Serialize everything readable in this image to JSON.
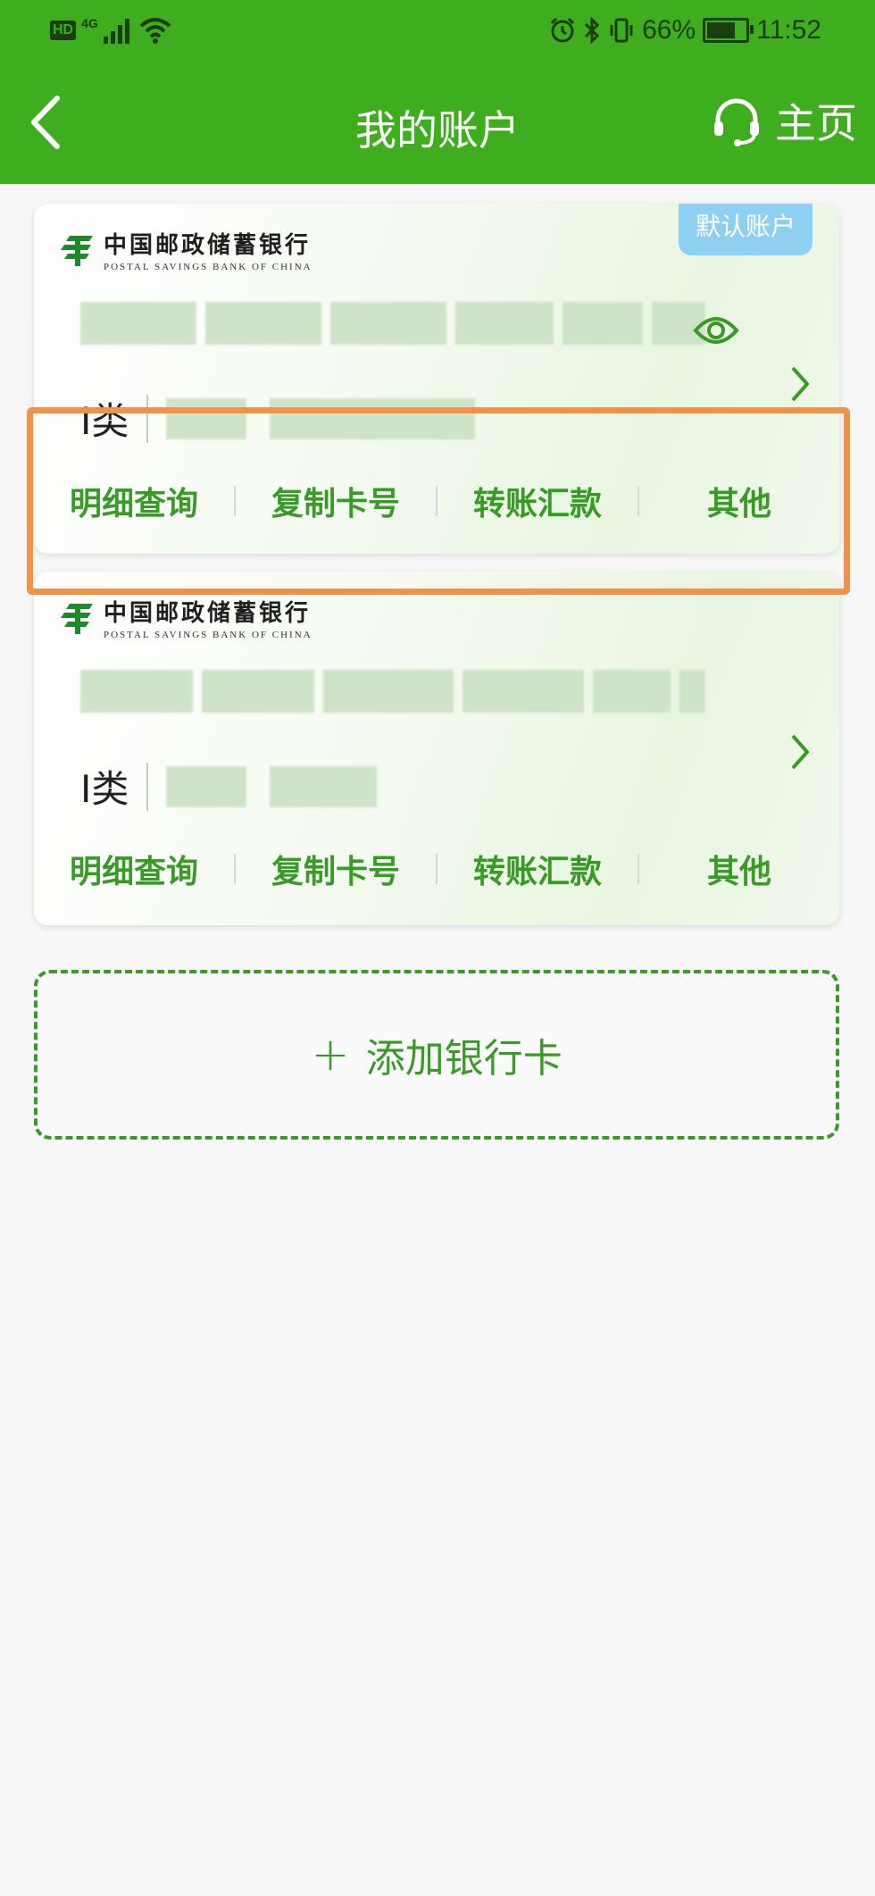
{
  "status_bar": {
    "hd": "HD",
    "network": "4G",
    "battery_percent": "66%",
    "battery_level": 0.66,
    "time": "11:52"
  },
  "nav": {
    "title": "我的账户",
    "home_label": "主页",
    "back_icon": "chevron-left-icon",
    "home_icon": "headset-icon"
  },
  "bank": {
    "name_cn": "中国邮政储蓄银行",
    "name_en": "POSTAL SAVINGS BANK OF CHINA"
  },
  "cards": [
    {
      "default_badge": "默认账户",
      "type_label": "I类",
      "actions": [
        "明细查询",
        "复制卡号",
        "转账汇款",
        "其他"
      ]
    },
    {
      "type_label": "I类",
      "actions": [
        "明细查询",
        "复制卡号",
        "转账汇款",
        "其他"
      ]
    }
  ],
  "add_card": {
    "label": "添加银行卡"
  },
  "colors": {
    "brand_green": "#3fae1e",
    "action_green": "#3a9a28",
    "highlight_orange": "#f09348",
    "badge_blue": "#8fd0f2"
  }
}
